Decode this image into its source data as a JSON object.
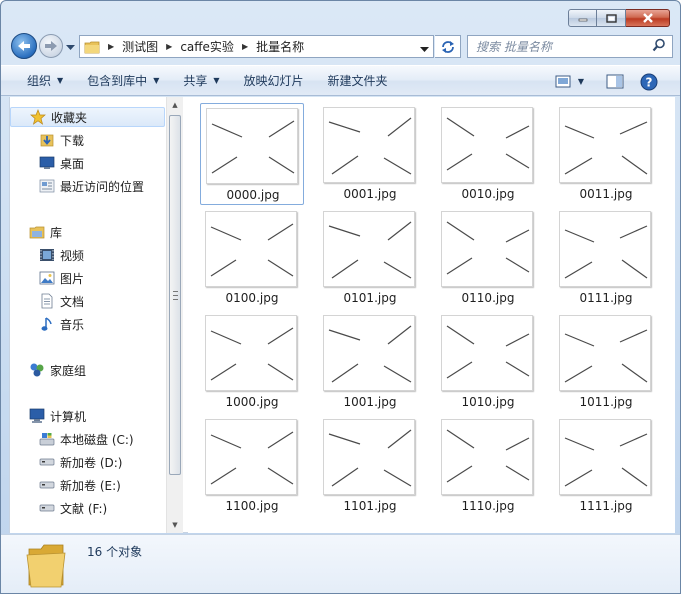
{
  "address": {
    "crumbs": [
      "测试图",
      "caffe实验",
      "批量名称"
    ]
  },
  "search": {
    "placeholder": "搜索 批量名称"
  },
  "toolbar": {
    "organize": "组织",
    "include_in_library": "包含到库中",
    "share": "共享",
    "slideshow": "放映幻灯片",
    "new_folder": "新建文件夹"
  },
  "sidebar": {
    "favorites": "收藏夹",
    "downloads": "下载",
    "desktop": "桌面",
    "recent": "最近访问的位置",
    "libraries": "库",
    "videos": "视频",
    "pictures": "图片",
    "documents": "文档",
    "music": "音乐",
    "homegroup": "家庭组",
    "computer": "计算机",
    "drive_c": "本地磁盘 (C:)",
    "drive_d": "新加卷 (D:)",
    "drive_e": "新加卷 (E:)",
    "drive_f": "文献 (F:)"
  },
  "files": [
    "0000.jpg",
    "0001.jpg",
    "0010.jpg",
    "0011.jpg",
    "0100.jpg",
    "0101.jpg",
    "0110.jpg",
    "0111.jpg",
    "1000.jpg",
    "1001.jpg",
    "1010.jpg",
    "1011.jpg",
    "1100.jpg",
    "1101.jpg",
    "1110.jpg",
    "1111.jpg"
  ],
  "status": {
    "count": "16 个对象"
  },
  "colors": {
    "window_frame": "#c9dcf1",
    "accent": "#1e395b",
    "close": "#c7452c"
  }
}
